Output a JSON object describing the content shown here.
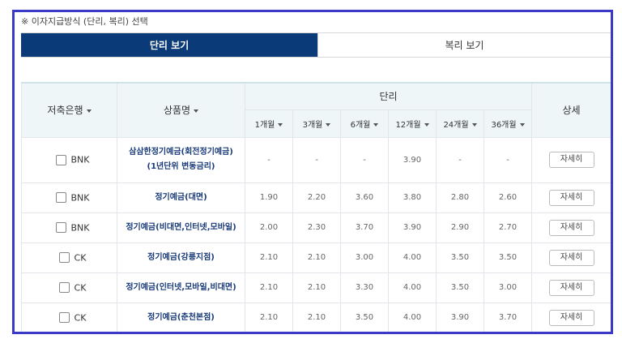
{
  "notice": "※ 이자지급방식 (단리, 복리) 선택",
  "tabs": {
    "simple": "단리 보기",
    "compound": "복리 보기"
  },
  "table": {
    "headers": {
      "bank": "저축은행",
      "product": "상품명",
      "rate_group": "단리",
      "detail": "상세",
      "months": [
        "1개월",
        "3개월",
        "6개월",
        "12개월",
        "24개월",
        "36개월"
      ]
    },
    "detail_label": "자세히",
    "rows": [
      {
        "bank": "BNK",
        "product": "삼삼한정기예금(회전정기예금) (1년단위 변동금리)",
        "rates": [
          "-",
          "-",
          "-",
          "3.90",
          "-",
          "-"
        ]
      },
      {
        "bank": "BNK",
        "product": "정기예금(대면)",
        "rates": [
          "1.90",
          "2.20",
          "3.60",
          "3.80",
          "2.80",
          "2.60"
        ]
      },
      {
        "bank": "BNK",
        "product": "정기예금(비대면,인터넷,모바일)",
        "rates": [
          "2.00",
          "2.30",
          "3.70",
          "3.90",
          "2.90",
          "2.70"
        ]
      },
      {
        "bank": "CK",
        "product": "정기예금(강릉지점)",
        "rates": [
          "2.10",
          "2.10",
          "3.00",
          "4.00",
          "3.50",
          "3.50"
        ]
      },
      {
        "bank": "CK",
        "product": "정기예금(인터넷,모바일,비대면)",
        "rates": [
          "2.10",
          "2.10",
          "3.30",
          "4.00",
          "3.50",
          "3.00"
        ]
      },
      {
        "bank": "CK",
        "product": "정기예금(춘천본점)",
        "rates": [
          "2.10",
          "2.10",
          "3.50",
          "4.00",
          "3.90",
          "3.70"
        ]
      }
    ]
  }
}
